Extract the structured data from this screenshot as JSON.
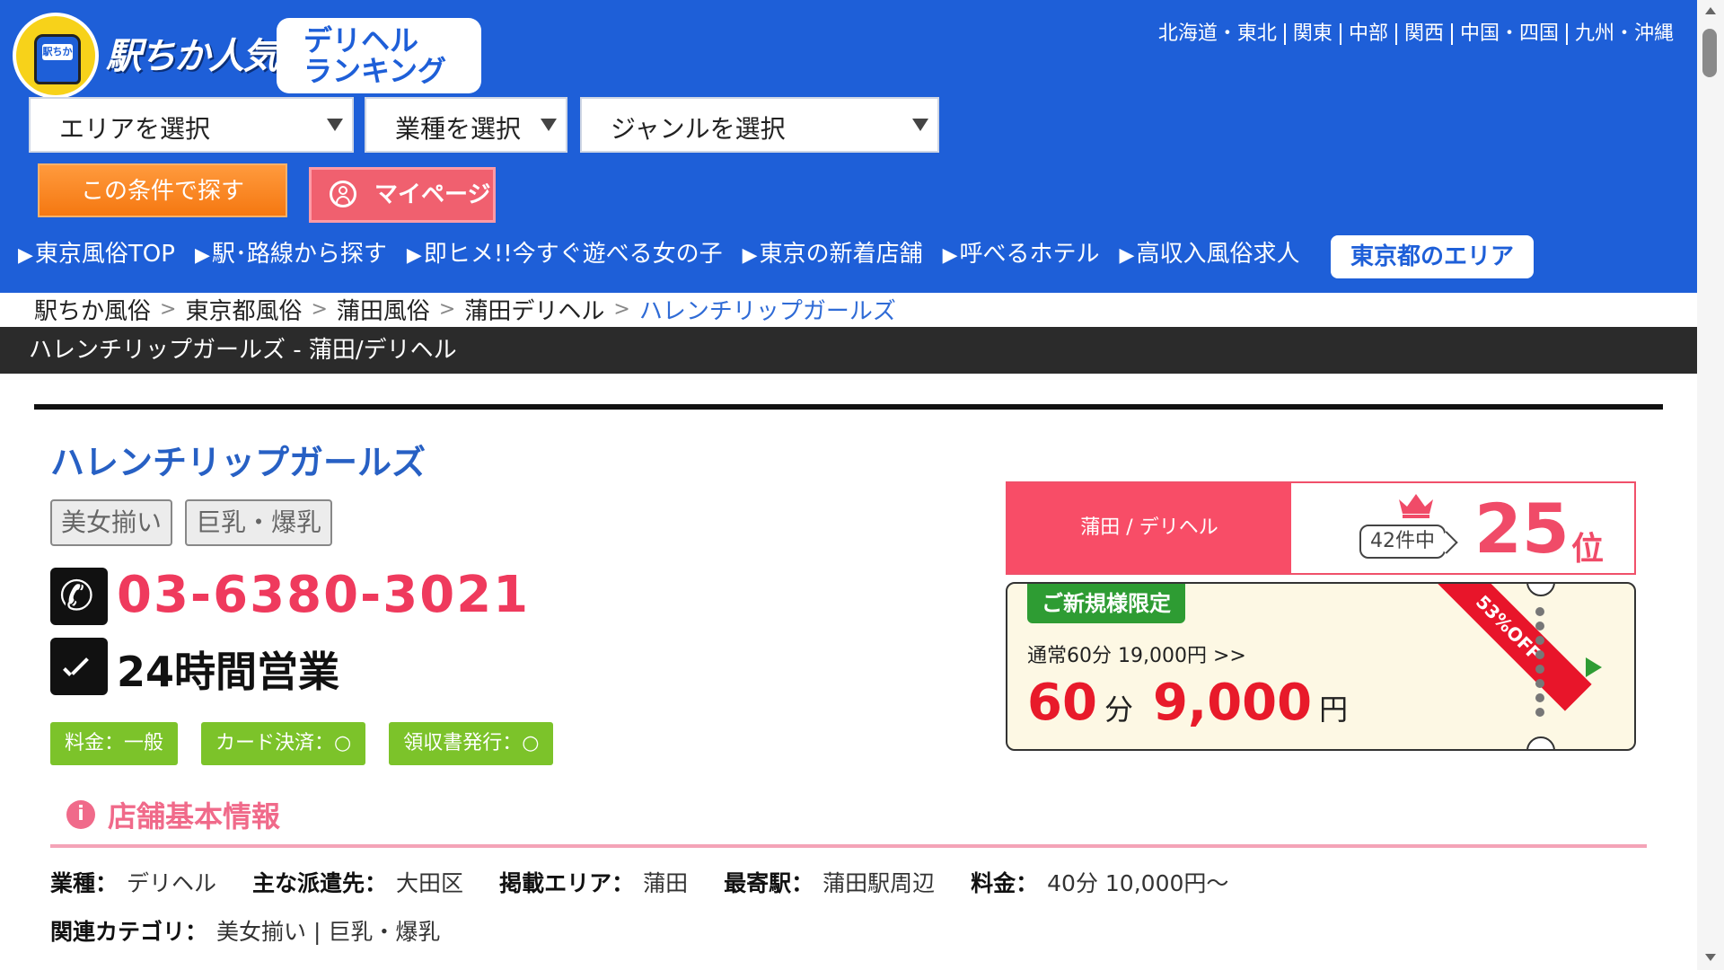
{
  "header": {
    "logo_text": "駅ちか人気!",
    "logo_badge_text": "駅ちか",
    "logo_sub_line1": "デリヘル",
    "logo_sub_line2": "ランキング",
    "regions": [
      "北海道・東北",
      "関東",
      "中部",
      "関西",
      "中国・四国",
      "九州・沖縄"
    ],
    "select_area": "エリアを選択",
    "select_type": "業種を選択",
    "select_genre": "ジャンルを選択",
    "search_button": "この条件で探す",
    "mypage_button": "マイページ",
    "nav": [
      "東京風俗TOP",
      "駅･路線から探す",
      "即ヒメ!!今すぐ遊べる女の子",
      "東京の新着店舗",
      "呼べるホテル",
      "高収入風俗求人"
    ],
    "nav_area_button": "東京都のエリア",
    "nav_marker": "▶"
  },
  "breadcrumb": {
    "items": [
      "駅ちか風俗",
      "東京都風俗",
      "蒲田風俗",
      "蒲田デリヘル"
    ],
    "current": "ハレンチリップガールズ",
    "separator": ">"
  },
  "title_bar": "ハレンチリップガールズ - 蒲田/デリヘル",
  "shop": {
    "name": "ハレンチリップガールズ",
    "tags": [
      "美女揃い",
      "巨乳・爆乳"
    ],
    "phone": "03-6380-3021",
    "hours": "24時間営業",
    "features": [
      "料金：一般",
      "カード決済：○",
      "領収書発行：○"
    ]
  },
  "ranking": {
    "label": "蒲田 / デリヘル",
    "count": "42件中",
    "rank": "25",
    "unit": "位"
  },
  "coupon": {
    "badge": "ご新規様限定",
    "normal_price": "通常60分 19,000円 >>",
    "minutes": "60",
    "minutes_unit": "分",
    "price": "9,000",
    "price_unit": "円",
    "discount": "53%OFF"
  },
  "basic_info": {
    "title": "店舗基本情報",
    "row1": [
      {
        "key": "業種：",
        "value": "デリヘル"
      },
      {
        "key": "主な派遣先：",
        "value": "大田区"
      },
      {
        "key": "掲載エリア：",
        "value": "蒲田"
      },
      {
        "key": "最寄駅：",
        "value": "蒲田駅周辺"
      },
      {
        "key": "料金：",
        "value": "40分 10,000円〜"
      }
    ],
    "row2": [
      {
        "key": "関連カテゴリ：",
        "value": "美女揃い | 巨乳・爆乳"
      }
    ]
  },
  "colors": {
    "header_blue": "#1e5fd8",
    "accent_pink": "#f04b68",
    "tag_green": "#7cc32a",
    "coupon_red": "#e81a2a"
  }
}
